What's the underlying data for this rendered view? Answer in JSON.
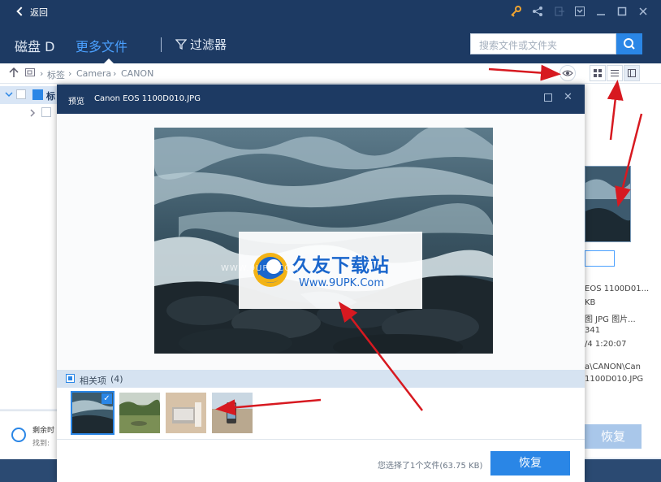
{
  "titlebar": {
    "back_label": "返回",
    "icons": [
      "key-icon",
      "share-icon",
      "exit-icon",
      "dropdown-icon",
      "minimize-icon",
      "maximize-icon",
      "close-icon"
    ]
  },
  "nav": {
    "tab_disk": "磁盘 D",
    "tab_more": "更多文件",
    "filter_label": "过滤器",
    "search_placeholder": "搜索文件或文件夹"
  },
  "path": {
    "items": [
      "标签",
      "Camera",
      "CANON"
    ]
  },
  "tree": {
    "row1_label": "标"
  },
  "right_panel": {
    "lines": [
      "EOS 1100D01...",
      "KB",
      "图 JPG 图片...",
      "341",
      "/4 1:20:07",
      "a\\CANON\\Can",
      "1100D010.JPG"
    ]
  },
  "bottom_left": {
    "line1": "剩余时",
    "line2": "找到:"
  },
  "restore_bg_label": "恢复",
  "preview": {
    "title_label": "预览",
    "file_name": "Canon EOS 1100D010.JPG",
    "related_label": "相关项",
    "related_count": "(4)",
    "status_text": "您选择了1个文件(63.75 KB)",
    "restore_label": "恢复"
  },
  "watermark": {
    "title": "久友下载站",
    "url": "Www.9UPK.Com",
    "faint": "WWW.9UPK.COM"
  },
  "colors": {
    "header": "#1d3a63",
    "accent": "#2a86e6",
    "arrow": "#d71920"
  }
}
